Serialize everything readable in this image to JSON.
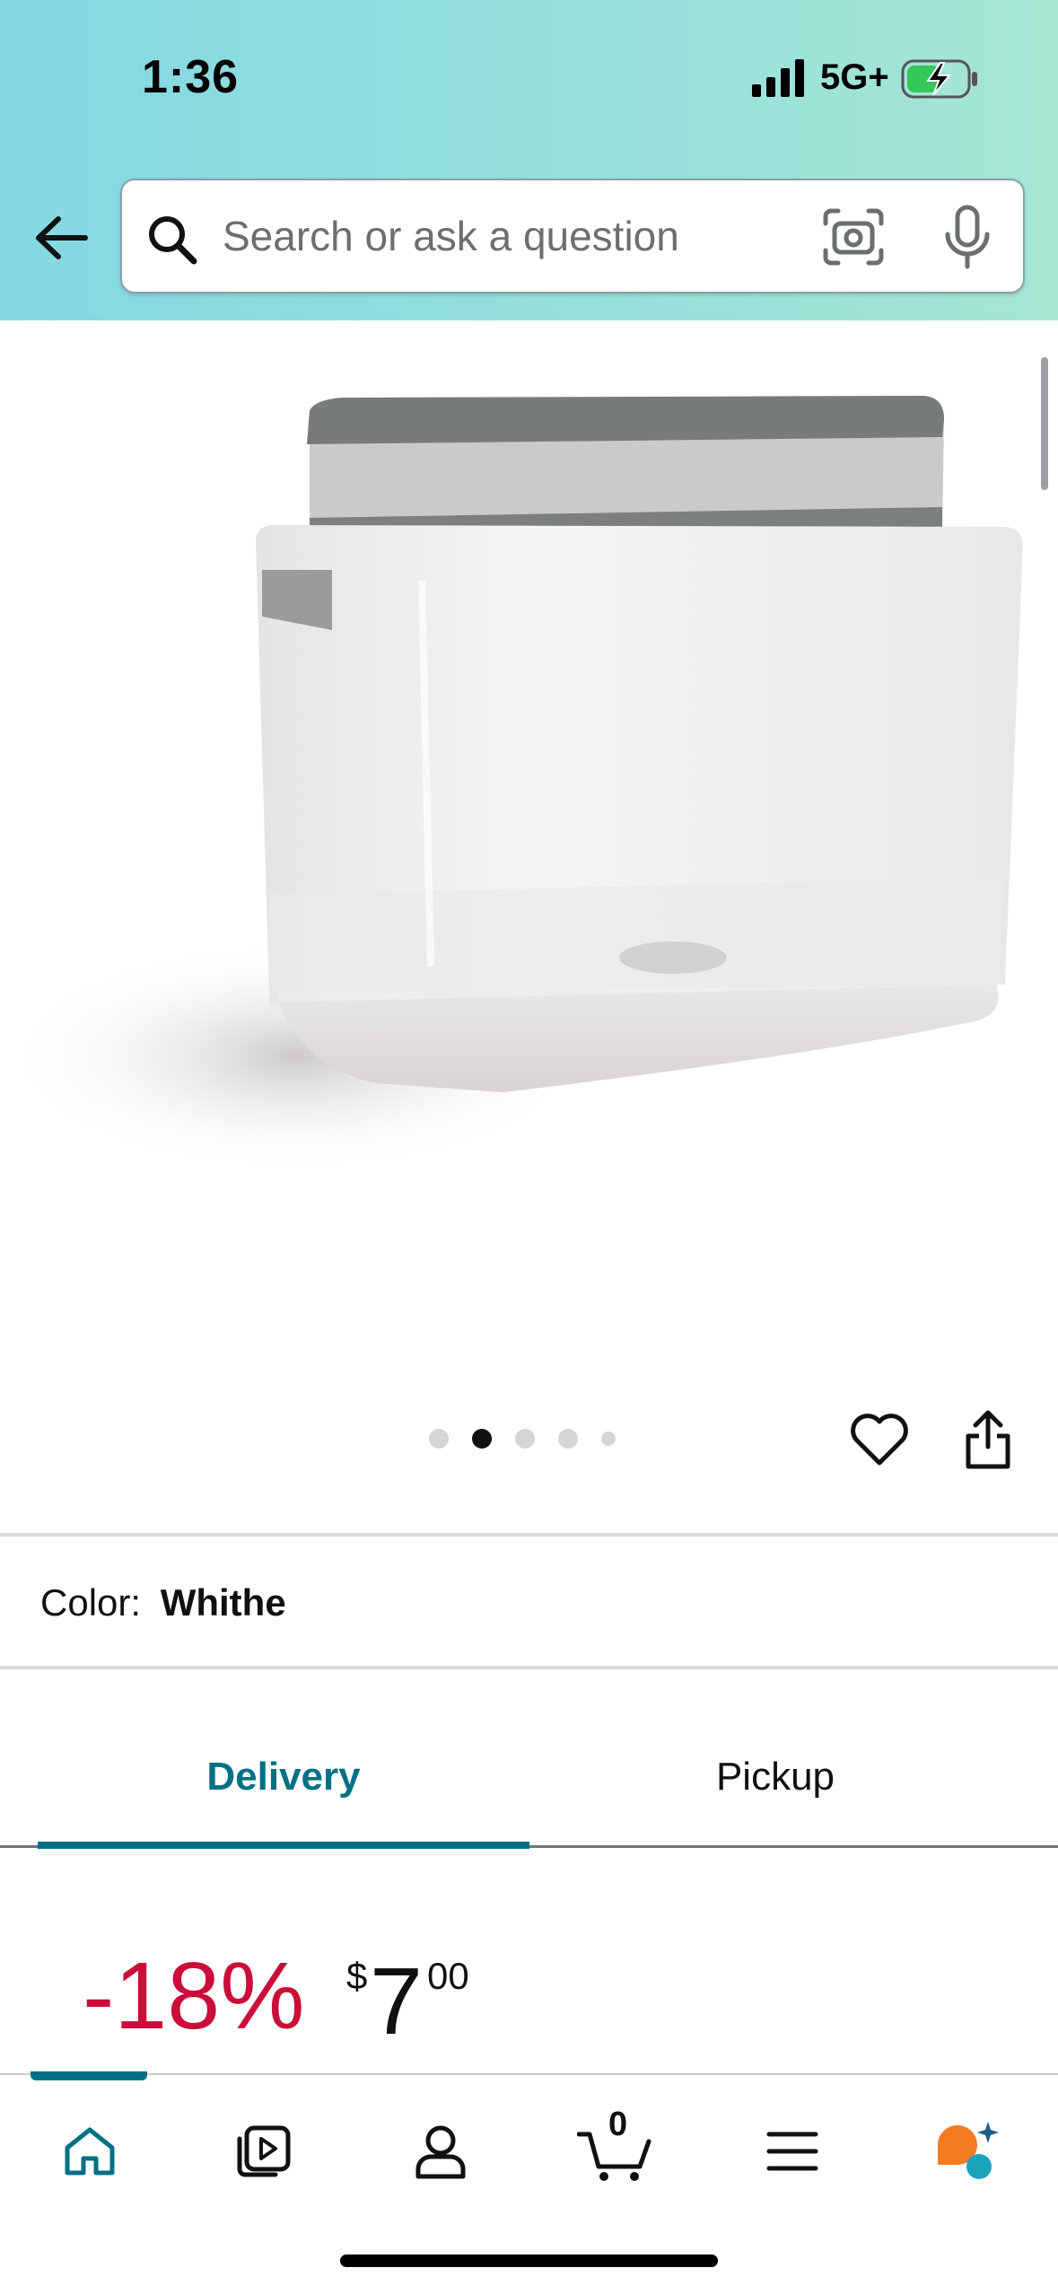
{
  "status_bar": {
    "time": "1:36",
    "network": "5G+"
  },
  "header": {
    "search_placeholder": "Search or ask a question"
  },
  "product": {
    "image_description_icon": "soap-dispenser-sponge-holder",
    "carousel": {
      "total": 5,
      "active_index": 1
    },
    "color_label": "Color:",
    "color_value": "Whithe"
  },
  "tabs": [
    {
      "label": "Delivery",
      "active": true
    },
    {
      "label": "Pickup",
      "active": false
    }
  ],
  "pricing": {
    "discount": "-18%",
    "currency_symbol": "$",
    "price_whole": "7",
    "price_fraction": "00"
  },
  "bottom_nav": {
    "items": [
      "home-icon",
      "video-icon",
      "account-icon",
      "cart-icon",
      "menu-icon",
      "rufus-icon"
    ],
    "cart_count": "0"
  },
  "colors": {
    "accent": "#007185",
    "discount": "#cc0c39",
    "header_gradient_start": "#84d8e3",
    "header_gradient_end": "#a6e6d3"
  }
}
